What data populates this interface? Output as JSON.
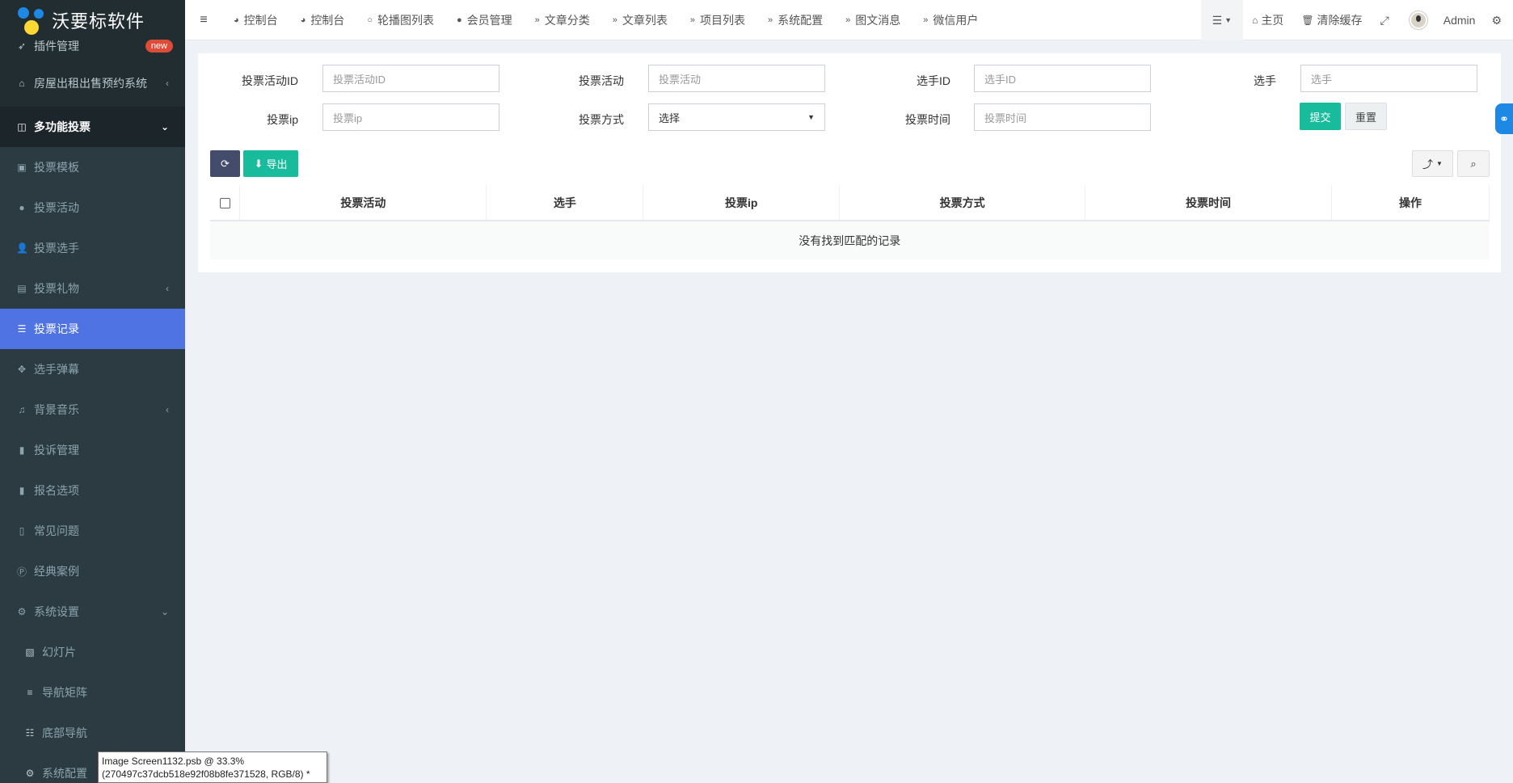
{
  "app": {
    "title": "沃要标软件"
  },
  "sidebar": {
    "items": [
      {
        "label": "插件管理",
        "icon": "rocket-icon",
        "badge": "new"
      },
      {
        "label": "房屋出租出售预约系统",
        "icon": "home-icon"
      },
      {
        "label": "多功能投票",
        "icon": "columns-icon"
      },
      {
        "label": "投票模板",
        "icon": "camera-icon"
      },
      {
        "label": "投票活动",
        "icon": "bomb-icon"
      },
      {
        "label": "投票选手",
        "icon": "user-plus-icon"
      },
      {
        "label": "投票礼物",
        "icon": "archive-icon"
      },
      {
        "label": "投票记录",
        "icon": "list-ol-icon"
      },
      {
        "label": "选手弹幕",
        "icon": "arrows-icon"
      },
      {
        "label": "背景音乐",
        "icon": "music-icon"
      },
      {
        "label": "投诉管理",
        "icon": "bookmark-icon"
      },
      {
        "label": "报名选项",
        "icon": "id-card-icon"
      },
      {
        "label": "常见问题",
        "icon": "file-word-icon"
      },
      {
        "label": "经典案例",
        "icon": "product-hunt-icon"
      },
      {
        "label": "系统设置",
        "icon": "cog-icon"
      },
      {
        "label": "幻灯片",
        "icon": "image-icon"
      },
      {
        "label": "导航矩阵",
        "icon": "bars-icon"
      },
      {
        "label": "底部导航",
        "icon": "list-icon"
      },
      {
        "label": "系统配置",
        "icon": "cogs-icon"
      }
    ]
  },
  "topbar": {
    "tabs": [
      {
        "label": "控制台",
        "icon": "dashboard-icon"
      },
      {
        "label": "控制台",
        "icon": "dashboard-icon"
      },
      {
        "label": "轮播图列表",
        "icon": "circle-icon"
      },
      {
        "label": "会员管理",
        "icon": "user-icon"
      },
      {
        "label": "文章分类",
        "icon": "angle-double-right-icon"
      },
      {
        "label": "文章列表",
        "icon": "angle-double-right-icon"
      },
      {
        "label": "项目列表",
        "icon": "angle-double-right-icon"
      },
      {
        "label": "系统配置",
        "icon": "angle-double-right-icon"
      },
      {
        "label": "图文消息",
        "icon": "angle-double-right-icon"
      },
      {
        "label": "微信用户",
        "icon": "angle-double-right-icon"
      }
    ],
    "home_label": "主页",
    "clear_cache_label": "清除缓存",
    "user_name": "Admin"
  },
  "filters": {
    "activity_id": {
      "label": "投票活动ID",
      "placeholder": "投票活动ID"
    },
    "activity": {
      "label": "投票活动",
      "placeholder": "投票活动"
    },
    "player_id": {
      "label": "选手ID",
      "placeholder": "选手ID"
    },
    "player": {
      "label": "选手",
      "placeholder": "选手"
    },
    "vote_ip": {
      "label": "投票ip",
      "placeholder": "投票ip"
    },
    "vote_method": {
      "label": "投票方式",
      "value": "选择"
    },
    "vote_time": {
      "label": "投票时间",
      "placeholder": "投票时间"
    },
    "submit_label": "提交",
    "reset_label": "重置"
  },
  "toolbar": {
    "export_label": "导出"
  },
  "table": {
    "columns": [
      "投票活动",
      "选手",
      "投票ip",
      "投票方式",
      "投票时间",
      "操作"
    ],
    "empty_text": "没有找到匹配的记录"
  },
  "statusbox": {
    "line1": "Image Screen1132.psb @ 33.3%",
    "line2": "(270497c37dcb518e92f08b8fe371528, RGB/8) *"
  },
  "colors": {
    "sidebar_bg": "#222d32",
    "active": "#4f73e3",
    "success": "#18bc9c",
    "danger": "#dd4b39"
  }
}
